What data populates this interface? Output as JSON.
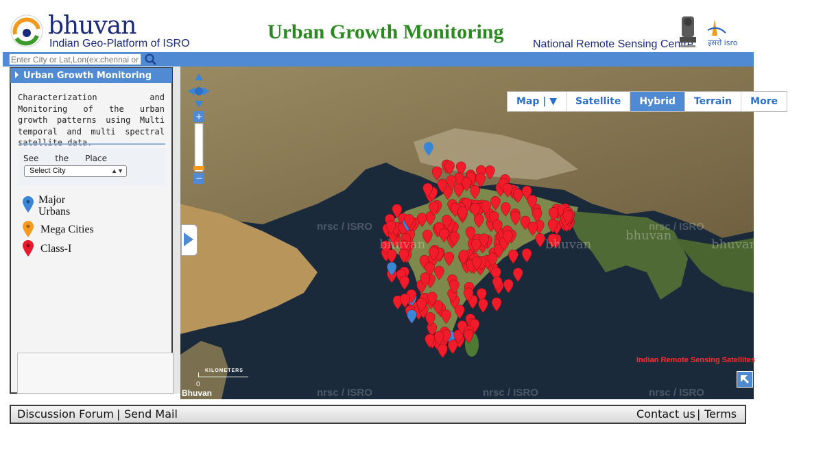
{
  "header": {
    "logo_word": "bhuvan",
    "logo_subtitle": "Indian Geo-Platform of ISRO",
    "title": "Urban Growth Monitoring",
    "org_name": "National Remote Sensing Centre"
  },
  "search": {
    "placeholder": "Enter City or Lat,Lon(ex:chennai or"
  },
  "panel": {
    "header_label": "Urban Growth Monitoring",
    "description": "Characterization and Monitoring of the urban growth patterns using Multi temporal and multi spectral satellite data.",
    "see_label_words": [
      "See",
      "the",
      "Place"
    ],
    "city_select_value": "Select City",
    "legend": [
      {
        "label": "Major Urbans",
        "color": "#3a86d6",
        "icon": "map-pin-icon"
      },
      {
        "label": "Mega Cities",
        "color": "#f59a23",
        "icon": "map-pin-icon"
      },
      {
        "label": "Class-I",
        "color": "#e8192c",
        "icon": "map-pin-icon"
      }
    ]
  },
  "map": {
    "layers": [
      "Map | ▼",
      "Satellite",
      "Hybrid",
      "Terrain",
      "More"
    ],
    "active_layer": "Hybrid",
    "watermark": "nrsc / ISRO",
    "watermark_logo": "bhuvan",
    "irs_label": "Indian Remote Sensing Satellites",
    "attribution": "Bhuvan",
    "scale_label": "KILOMETERS",
    "scale_zero": "0",
    "colors": {
      "water": "#1b2a3b",
      "land": "#8a7a52",
      "marker": "#f21b2a",
      "marker_blue": "#3a86d6"
    }
  },
  "footer": {
    "left_links": [
      "Discussion Forum",
      "Send Mail"
    ],
    "right_links": [
      "Contact us",
      "Terms"
    ],
    "separator": "|"
  }
}
